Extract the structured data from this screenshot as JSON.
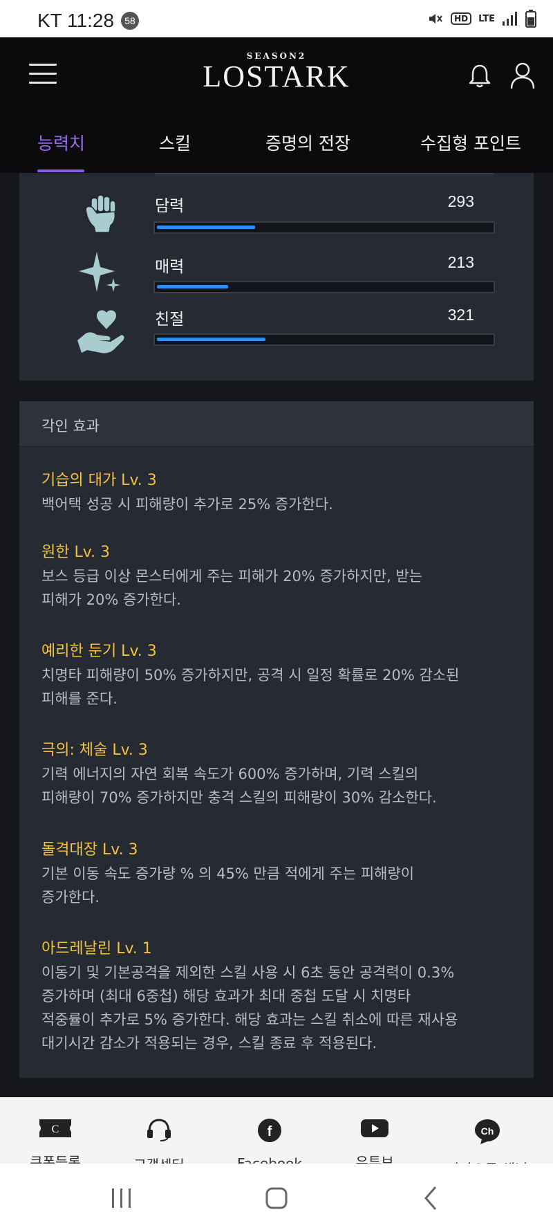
{
  "status_bar": {
    "carrier_time": "KT 11:28",
    "notification_count": "58",
    "network": "LTE",
    "hd_label": "HD"
  },
  "header": {
    "logo_season": "SEASON2",
    "logo_main": "LOSTARK"
  },
  "tabs": [
    {
      "label": "능력치",
      "active": true
    },
    {
      "label": "스킬",
      "active": false
    },
    {
      "label": "증명의 전장",
      "active": false
    },
    {
      "label": "수집형 포인트",
      "active": false
    }
  ],
  "stats": [
    {
      "label": "담력",
      "value": "293",
      "icon": "fist-icon",
      "fill_fraction": 0.29
    },
    {
      "label": "매력",
      "value": "213",
      "icon": "sparkle-icon",
      "fill_fraction": 0.21
    },
    {
      "label": "친절",
      "value": "321",
      "icon": "heart-hand-icon",
      "fill_fraction": 0.32
    }
  ],
  "engravings": {
    "title": "각인 효과",
    "effects": [
      {
        "name": "기습의 대가 Lv. 3",
        "desc": "백어택 성공 시 피해량이 추가로 25% 증가한다."
      },
      {
        "name": "원한 Lv. 3",
        "desc": "보스 등급 이상 몬스터에게 주는 피해가 20% 증가하지만, 받는\n피해가 20% 증가한다."
      },
      {
        "name": "예리한 둔기 Lv. 3",
        "desc": "치명타 피해량이 50% 증가하지만, 공격 시 일정 확률로 20% 감소된\n피해를 준다."
      },
      {
        "name": "극의: 체술 Lv. 3",
        "desc": "기력 에너지의 자연 회복 속도가 600% 증가하며, 기력 스킬의\n피해량이 70% 증가하지만 충격 스킬의 피해량이 30% 감소한다."
      },
      {
        "name": "돌격대장 Lv. 3",
        "desc": "기본 이동 속도 증가량 % 의 45% 만큼 적에게 주는 피해량이\n증가한다."
      },
      {
        "name": "아드레날린 Lv. 1",
        "desc": "이동기 및 기본공격을 제외한 스킬 사용 시 6초 동안 공격력이 0.3%\n증가하며 (최대 6중첩) 해당 효과가 최대 중첩 도달 시 치명타\n적중률이 추가로 5% 증가한다. 해당 효과는 스킬 취소에 따른 재사용\n대기시간 감소가 적용되는 경우, 스킬 종료 후 적용된다."
      }
    ]
  },
  "footer": [
    {
      "label": "쿠폰등록",
      "icon": "coupon-icon"
    },
    {
      "label": "고객센터",
      "icon": "headset-icon"
    },
    {
      "label": "Facebook",
      "icon": "facebook-icon"
    },
    {
      "label": "유튜브",
      "icon": "youtube-icon"
    },
    {
      "label": "카카오톡 채널",
      "icon": "kakao-channel-icon"
    }
  ],
  "colors": {
    "accent_purple": "#9b6cf0",
    "engraving_name": "#f3c33d",
    "stat_bar_fill": "#2f8df0",
    "panel_bg": "#262a33"
  }
}
